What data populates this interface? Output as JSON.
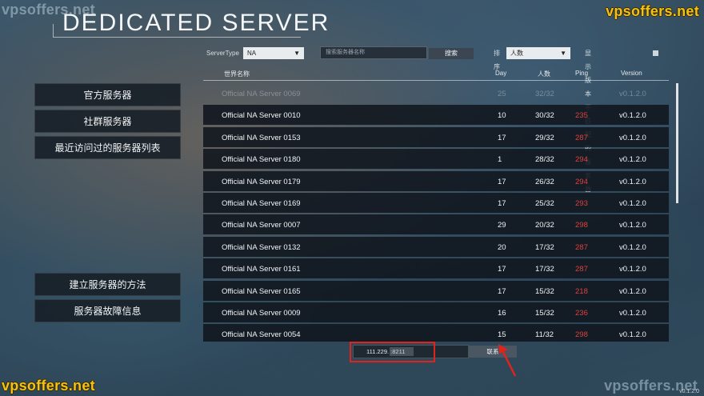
{
  "watermarks": {
    "top_left": "vpsoffers.net",
    "top_right": "vpsoffers.net",
    "bottom_left": "vpsoffers.net",
    "bottom_right": "vpsoffers.net"
  },
  "title": "DEDICATED SERVER",
  "menu": {
    "official": "官方服务器",
    "community": "社群服务器",
    "recent": "最近访问过的服务器列表",
    "howto": "建立服务器的方法",
    "troubleshoot": "服务器故障信息"
  },
  "filter": {
    "server_type_label": "ServerType",
    "server_type_value": "NA",
    "search_placeholder": "搜索服务器名称",
    "search_button": "搜索",
    "sort_label": "排序",
    "sort_value": "人数",
    "mismatch_label": "显示版本不匹配的服务器"
  },
  "table": {
    "headers": {
      "name": "世界名称",
      "day": "Day",
      "count": "人数",
      "ping": "Ping",
      "version": "Version"
    },
    "rows": [
      {
        "name": "Official NA Server 0069",
        "day": "25",
        "count": "32/32",
        "ping": "",
        "version": "v0.1.2.0"
      },
      {
        "name": "Official NA Server 0010",
        "day": "10",
        "count": "30/32",
        "ping": "235",
        "version": "v0.1.2.0"
      },
      {
        "name": "Official NA Server 0153",
        "day": "17",
        "count": "29/32",
        "ping": "287",
        "version": "v0.1.2.0"
      },
      {
        "name": "Official NA Server 0180",
        "day": "1",
        "count": "28/32",
        "ping": "294",
        "version": "v0.1.2.0"
      },
      {
        "name": "Official NA Server 0179",
        "day": "17",
        "count": "26/32",
        "ping": "294",
        "version": "v0.1.2.0"
      },
      {
        "name": "Official NA Server 0169",
        "day": "17",
        "count": "25/32",
        "ping": "293",
        "version": "v0.1.2.0"
      },
      {
        "name": "Official NA Server 0007",
        "day": "29",
        "count": "20/32",
        "ping": "298",
        "version": "v0.1.2.0"
      },
      {
        "name": "Official NA Server 0132",
        "day": "20",
        "count": "17/32",
        "ping": "287",
        "version": "v0.1.2.0"
      },
      {
        "name": "Official NA Server 0161",
        "day": "17",
        "count": "17/32",
        "ping": "287",
        "version": "v0.1.2.0"
      },
      {
        "name": "Official NA Server 0165",
        "day": "17",
        "count": "15/32",
        "ping": "218",
        "version": "v0.1.2.0"
      },
      {
        "name": "Official NA Server 0009",
        "day": "16",
        "count": "15/32",
        "ping": "236",
        "version": "v0.1.2.0"
      },
      {
        "name": "Official NA Server 0054",
        "day": "15",
        "count": "11/32",
        "ping": "298",
        "version": "v0.1.2.0"
      }
    ]
  },
  "connect": {
    "ip_value": "111.229.      :8211",
    "button": "联系"
  },
  "version_label": "v0.1.2.0",
  "colors": {
    "ping": "#e0413c",
    "highlight": "#e0231c",
    "watermark": "#f0c21a"
  }
}
